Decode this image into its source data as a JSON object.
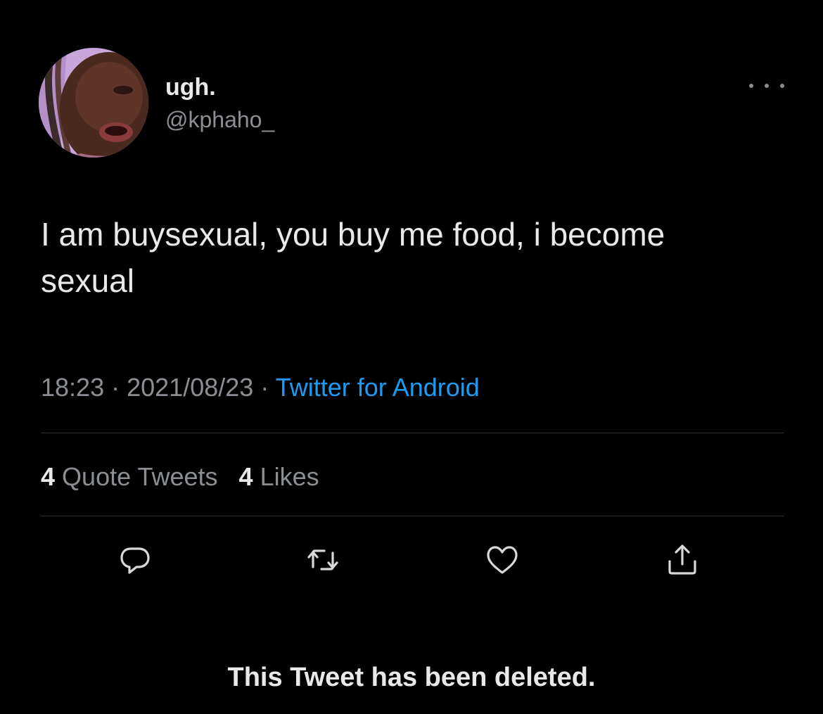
{
  "user": {
    "display_name": "ugh.",
    "handle": "@kphaho_"
  },
  "tweet": {
    "text": "I am buysexual, you buy me food, i become sexual",
    "time": "18:23",
    "date": "2021/08/23",
    "separator": "·",
    "source": "Twitter for Android"
  },
  "stats": {
    "quote_count": "4",
    "quote_label": "Quote Tweets",
    "like_count": "4",
    "like_label": "Likes"
  },
  "icons": {
    "more": "more-horizontal-icon",
    "reply": "reply-icon",
    "retweet": "retweet-icon",
    "like": "heart-icon",
    "share": "share-icon"
  },
  "notice": "This Tweet has been deleted.",
  "colors": {
    "background": "#000000",
    "text": "#e7e9ea",
    "secondary": "#8b8f94",
    "link": "#1d9bf0",
    "divider": "#2f3336"
  }
}
